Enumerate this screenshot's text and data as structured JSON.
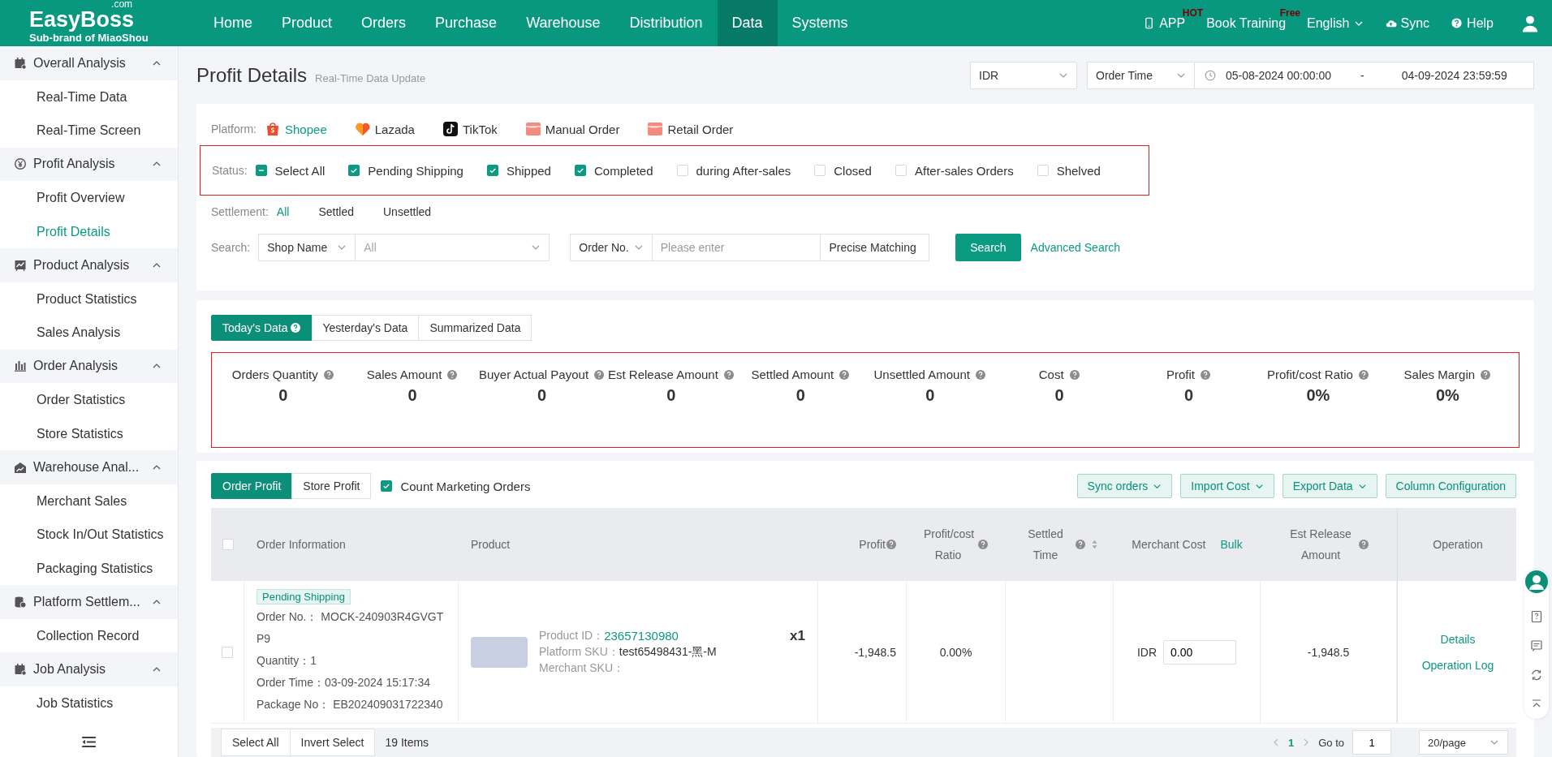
{
  "brand": {
    "logo": "EasyBoss",
    "logo_suffix": ".com",
    "tagline": "Sub-brand of MiaoShou"
  },
  "nav": [
    {
      "label": "Home",
      "selected": false
    },
    {
      "label": "Product",
      "selected": false
    },
    {
      "label": "Orders",
      "selected": false
    },
    {
      "label": "Purchase",
      "selected": false
    },
    {
      "label": "Warehouse",
      "selected": false
    },
    {
      "label": "Distribution",
      "selected": false
    },
    {
      "label": "Data",
      "selected": true
    },
    {
      "label": "Systems",
      "selected": false
    }
  ],
  "header_actions": [
    {
      "kind": "app",
      "label": "APP",
      "badge": "HOT"
    },
    {
      "kind": "training",
      "label": "Book Training",
      "badge": "Free"
    },
    {
      "kind": "language",
      "label": "English"
    },
    {
      "kind": "sync",
      "label": "Sync"
    },
    {
      "kind": "help",
      "label": "Help"
    },
    {
      "kind": "user"
    }
  ],
  "sidebar": [
    {
      "label": "Overall Analysis",
      "expanded": true,
      "children": [
        {
          "label": "Real-Time Data",
          "selected": false
        },
        {
          "label": "Real-Time Screen",
          "selected": false
        }
      ]
    },
    {
      "label": "Profit Analysis",
      "expanded": true,
      "children": [
        {
          "label": "Profit Overview",
          "selected": false
        },
        {
          "label": "Profit Details",
          "selected": true
        }
      ]
    },
    {
      "label": "Product Analysis",
      "expanded": true,
      "children": [
        {
          "label": "Product Statistics",
          "selected": false
        },
        {
          "label": "Sales Analysis",
          "selected": false
        }
      ]
    },
    {
      "label": "Order Analysis",
      "expanded": true,
      "children": [
        {
          "label": "Order Statistics",
          "selected": false
        },
        {
          "label": "Store Statistics",
          "selected": false
        }
      ]
    },
    {
      "label": "Warehouse Anal...",
      "expanded": true,
      "children": [
        {
          "label": "Merchant Sales",
          "selected": false
        },
        {
          "label": "Stock In/Out Statistics",
          "selected": false
        },
        {
          "label": "Packaging Statistics",
          "selected": false
        }
      ]
    },
    {
      "label": "Platform Settlem...",
      "expanded": true,
      "children": [
        {
          "label": "Collection Record",
          "selected": false
        }
      ]
    },
    {
      "label": "Job Analysis",
      "expanded": true,
      "children": [
        {
          "label": "Job Statistics",
          "selected": false
        }
      ]
    }
  ],
  "page": {
    "title": "Profit Details",
    "subtitle": "Real-Time Data Update",
    "currency": "IDR",
    "time_type": "Order Time",
    "date_start": "05-08-2024 00:00:00",
    "date_separator": "-",
    "date_end": "04-09-2024 23:59:59"
  },
  "filters": {
    "platform_label": "Platform:",
    "platforms": [
      {
        "label": "Shopee",
        "selected": true
      },
      {
        "label": "Lazada",
        "selected": false
      },
      {
        "label": "TikTok",
        "selected": false
      },
      {
        "label": "Manual Order",
        "selected": false
      },
      {
        "label": "Retail Order",
        "selected": false
      }
    ],
    "status_label": "Status:",
    "statuses": [
      {
        "kind": "select_all",
        "label": "Select All",
        "checked": true
      },
      {
        "kind": "option",
        "label": "Pending Shipping",
        "checked": true
      },
      {
        "kind": "option",
        "label": "Shipped",
        "checked": true
      },
      {
        "kind": "option",
        "label": "Completed",
        "checked": true
      },
      {
        "kind": "option",
        "label": "during After-sales",
        "checked": false
      },
      {
        "kind": "option",
        "label": "Closed",
        "checked": false
      },
      {
        "kind": "option",
        "label": "After-sales Orders",
        "checked": false
      },
      {
        "kind": "option",
        "label": "Shelved",
        "checked": false
      }
    ],
    "settlement_label": "Settlement:",
    "settlements": [
      {
        "label": "All",
        "selected": true
      },
      {
        "label": "Settled",
        "selected": false
      },
      {
        "label": "Unsettled",
        "selected": false
      }
    ],
    "search_label": "Search:",
    "shop_field": "Shop Name",
    "shop_placeholder": "All",
    "order_field": "Order No.",
    "order_placeholder": "Please enter",
    "match_mode": "Precise Matching",
    "search_button": "Search",
    "advanced_search": "Advanced Search"
  },
  "data_tabs": [
    {
      "label": "Today's Data",
      "selected": true
    },
    {
      "label": "Yesterday's Data",
      "selected": false
    },
    {
      "label": "Summarized Data",
      "selected": false
    }
  ],
  "stats": [
    {
      "label": "Orders Quantity",
      "value": "0"
    },
    {
      "label": "Sales Amount",
      "value": "0"
    },
    {
      "label": "Buyer Actual Payout",
      "value": "0"
    },
    {
      "label": "Est Release Amount",
      "value": "0"
    },
    {
      "label": "Settled Amount",
      "value": "0"
    },
    {
      "label": "Unsettled Amount",
      "value": "0"
    },
    {
      "label": "Cost",
      "value": "0"
    },
    {
      "label": "Profit",
      "value": "0"
    },
    {
      "label": "Profit/cost Ratio",
      "value": "0%"
    },
    {
      "label": "Sales Margin",
      "value": "0%"
    }
  ],
  "table_tabs": [
    {
      "label": "Order Profit",
      "selected": true
    },
    {
      "label": "Store Profit",
      "selected": false
    }
  ],
  "count_marketing": {
    "label": "Count Marketing Orders",
    "checked": true
  },
  "table_actions": [
    {
      "label": "Sync orders",
      "dropdown": true
    },
    {
      "label": "Import Cost",
      "dropdown": true
    },
    {
      "label": "Export Data",
      "dropdown": true
    },
    {
      "label": "Column Configuration",
      "dropdown": false
    }
  ],
  "header_checkbox_checked": false,
  "columns": [
    {
      "label": "Order Information",
      "help": false,
      "sortable": false
    },
    {
      "label": "Product",
      "help": false,
      "sortable": false
    },
    {
      "label": "Profit",
      "help": true,
      "sortable": false
    },
    {
      "label": "Profit/cost Ratio",
      "help": true,
      "sortable": false
    },
    {
      "label": "Settled Time",
      "help": true,
      "sortable": true
    },
    {
      "label": "Merchant Cost",
      "help": false,
      "sortable": false,
      "link": "Bulk"
    },
    {
      "label": "Est Release Amount",
      "help": true,
      "sortable": false
    },
    {
      "label": "Operation",
      "help": false,
      "sortable": false
    }
  ],
  "rows": [
    {
      "checked": false,
      "status": "Pending Shipping",
      "order_no": "Order No.： MOCK-240903R4GVGTP9",
      "quantity": "Quantity：1",
      "order_time": "Order Time：03-09-2024 15:17:34",
      "package_no": "Package No： EB202409031722340",
      "product_id_label": "Product ID：",
      "product_id": "23657130980",
      "platform_sku_label": "Platform SKU：",
      "platform_sku": "test65498431-黑-M",
      "merchant_sku_label": "Merchant SKU：",
      "qty": "x1",
      "profit": "-1,948.5",
      "ratio": "0.00%",
      "currency": "IDR",
      "merchant_cost": "0.00",
      "est_release": "-1,948.5",
      "operations": [
        "Details",
        "Operation Log"
      ]
    }
  ],
  "footer": {
    "select_all": "Select All",
    "invert_select": "Invert Select",
    "count": "19 Items",
    "page": "1",
    "goto_label": "Go to",
    "goto_value": "1",
    "page_size": "20/page"
  }
}
